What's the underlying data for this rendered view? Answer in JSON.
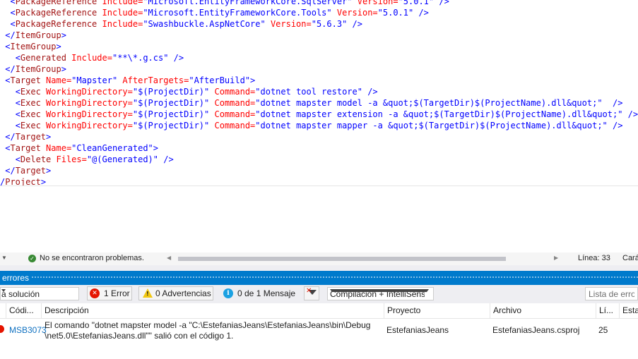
{
  "editor": {
    "lines": [
      [
        "  <PackageReference ",
        "Include=",
        "\"Microsoft.EntityFrameworkCore.SqlServer\" ",
        "Version=",
        "\"5.0.1\" />"
      ],
      [
        "  <PackageReference ",
        "Include=",
        "\"Microsoft.EntityFrameworkCore.Tools\" ",
        "Version=",
        "\"5.0.1\" />"
      ],
      [
        "  <PackageReference ",
        "Include=",
        "\"Swashbuckle.AspNetCore\" ",
        "Version=",
        "\"5.6.3\" />"
      ],
      [
        " </ItemGroup>"
      ],
      [
        " <ItemGroup>"
      ],
      [
        "   <Generated ",
        "Include=",
        "\"**\\*.g.cs\" />"
      ],
      [
        " </ItemGroup>"
      ],
      [
        " <Target ",
        "Name=",
        "\"Mapster\" ",
        "AfterTargets=",
        "\"AfterBuild\">"
      ],
      [
        "   <Exec ",
        "WorkingDirectory=",
        "\"$(ProjectDir)\" ",
        "Command=",
        "\"dotnet tool restore\" />"
      ],
      [
        "   <Exec ",
        "WorkingDirectory=",
        "\"$(ProjectDir)\" ",
        "Command=",
        "\"dotnet mapster model -a &quot;$(TargetDir)$(ProjectName).dll&quot;\"  />"
      ],
      [
        "   <Exec ",
        "WorkingDirectory=",
        "\"$(ProjectDir)\" ",
        "Command=",
        "\"dotnet mapster extension -a &quot;$(TargetDir)$(ProjectName).dll&quot;\" />"
      ],
      [
        "   <Exec ",
        "WorkingDirectory=",
        "\"$(ProjectDir)\" ",
        "Command=",
        "\"dotnet mapster mapper -a &quot;$(TargetDir)$(ProjectName).dll&quot;\" />"
      ],
      [
        " </Target>"
      ],
      [
        " <Target ",
        "Name=",
        "\"CleanGenerated\">"
      ],
      [
        "   <Delete ",
        "Files=",
        "\"@(Generated)\" />"
      ],
      [
        " </Target>"
      ],
      [
        "/Project>"
      ]
    ]
  },
  "status": {
    "message": "No se encontraron problemas.",
    "line": "Línea: 33",
    "char": "Cará"
  },
  "errors_panel": {
    "title": "errores",
    "scope": "a solución",
    "errors_button": "1 Error",
    "warnings_button": "0 Advertencias",
    "messages_button": "0 de 1 Mensaje",
    "build_filter": "Compilación + IntelliSense",
    "search_placeholder": "Lista de errores",
    "columns": [
      "Códi...",
      "Descripción",
      "Proyecto",
      "Archivo",
      "Lí...",
      "Esta"
    ],
    "rows": [
      {
        "code": "MSB3073",
        "description_line1": "El comando \"dotnet mapster model -a \"C:\\EstefaniasJeans\\EstefaniasJeans\\bin\\Debug",
        "description_line2": "\\net5.0\\EstefaniasJeans.dll\"\" salió con el código 1.",
        "project": "EstefaniasJeans",
        "file": "EstefaniasJeans.csproj",
        "line": "25"
      }
    ]
  }
}
